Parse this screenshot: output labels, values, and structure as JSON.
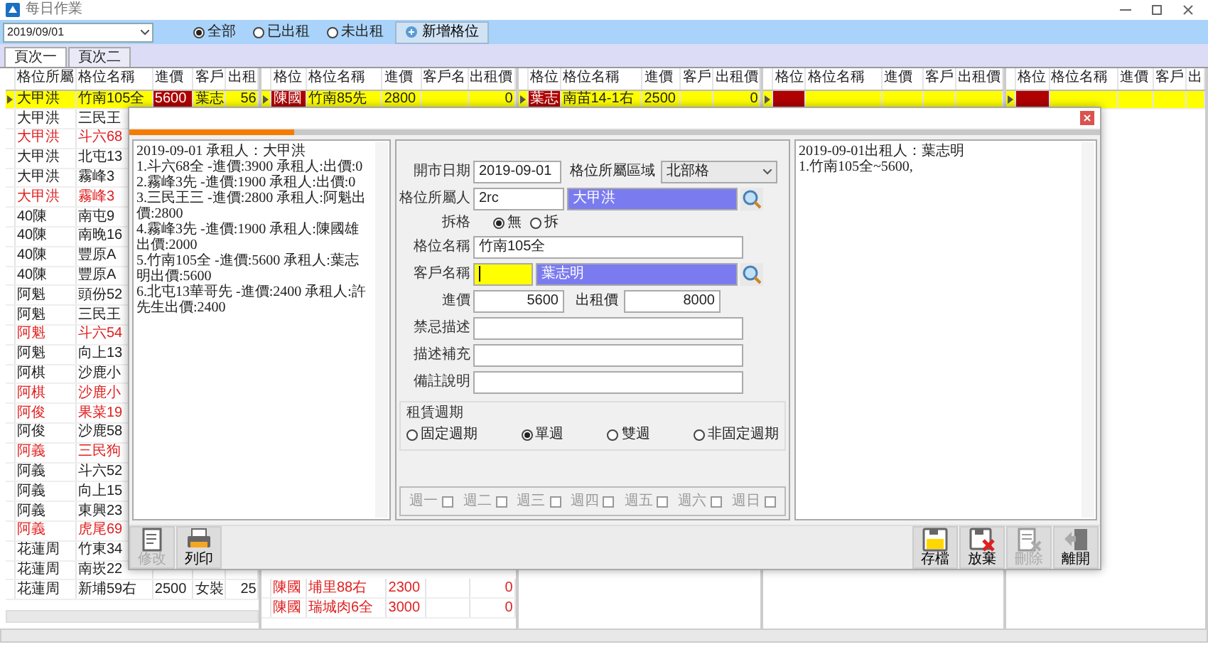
{
  "window": {
    "title": "每日作業"
  },
  "toolbar": {
    "date": "2019/09/01",
    "filters": [
      {
        "label": "全部",
        "selected": true
      },
      {
        "label": "已出租",
        "selected": false
      },
      {
        "label": "未出租",
        "selected": false
      }
    ],
    "add_button": "新增格位"
  },
  "tabs": [
    {
      "label": "頁次一",
      "selected": true
    },
    {
      "label": "頁次二",
      "selected": false
    }
  ],
  "grids": [
    {
      "columns": [
        "格位所屬",
        "格位名稱",
        "進價",
        "客戶",
        "出租"
      ],
      "rows": [
        {
          "cells": [
            "大甲洪",
            "竹南105全",
            {
              "text": "5600",
              "marked": true
            },
            "葉志",
            "56"
          ],
          "selected": true,
          "flagged": false
        },
        {
          "cells": [
            "大甲洪",
            "三民王"
          ],
          "selected": false,
          "flagged": false
        },
        {
          "cells": [
            "大甲洪",
            "斗六68"
          ],
          "selected": false,
          "flagged": true
        },
        {
          "cells": [
            "大甲洪",
            "北屯13"
          ],
          "selected": false,
          "flagged": false
        },
        {
          "cells": [
            "大甲洪",
            "霧峰3"
          ],
          "selected": false,
          "flagged": false
        },
        {
          "cells": [
            "大甲洪",
            "霧峰3"
          ],
          "selected": false,
          "flagged": true
        },
        {
          "cells": [
            "40陳",
            "南屯9"
          ],
          "selected": false,
          "flagged": false
        },
        {
          "cells": [
            "40陳",
            "南晚16"
          ],
          "selected": false,
          "flagged": false
        },
        {
          "cells": [
            "40陳",
            "豐原A"
          ],
          "selected": false,
          "flagged": false
        },
        {
          "cells": [
            "40陳",
            "豐原A"
          ],
          "selected": false,
          "flagged": false
        },
        {
          "cells": [
            "阿魁",
            "頭份52"
          ],
          "selected": false,
          "flagged": false
        },
        {
          "cells": [
            "阿魁",
            "三民王"
          ],
          "selected": false,
          "flagged": false
        },
        {
          "cells": [
            "阿魁",
            "斗六54"
          ],
          "selected": false,
          "flagged": true
        },
        {
          "cells": [
            "阿魁",
            "向上13"
          ],
          "selected": false,
          "flagged": false
        },
        {
          "cells": [
            "阿棋",
            "沙鹿小"
          ],
          "selected": false,
          "flagged": false
        },
        {
          "cells": [
            "阿棋",
            "沙鹿小"
          ],
          "selected": false,
          "flagged": true
        },
        {
          "cells": [
            "阿俊",
            "果菜19"
          ],
          "selected": false,
          "flagged": true
        },
        {
          "cells": [
            "阿俊",
            "沙鹿58"
          ],
          "selected": false,
          "flagged": false
        },
        {
          "cells": [
            "阿義",
            "三民狗"
          ],
          "selected": false,
          "flagged": true
        },
        {
          "cells": [
            "阿義",
            "斗六52"
          ],
          "selected": false,
          "flagged": false
        },
        {
          "cells": [
            "阿義",
            "向上15"
          ],
          "selected": false,
          "flagged": false
        },
        {
          "cells": [
            "阿義",
            "東興23"
          ],
          "selected": false,
          "flagged": false
        },
        {
          "cells": [
            "阿義",
            "虎尾69"
          ],
          "selected": false,
          "flagged": true
        },
        {
          "cells": [
            "花蓮周",
            "竹東34"
          ],
          "selected": false,
          "flagged": false
        },
        {
          "cells": [
            "花蓮周",
            "南崁22"
          ],
          "selected": false,
          "flagged": false
        },
        {
          "cells": [
            "花蓮周",
            "新埔59右",
            "2500",
            "女裝",
            "25"
          ],
          "selected": false,
          "flagged": false
        }
      ]
    },
    {
      "columns": [
        "格位",
        "格位名稱",
        "進價",
        "客戶名",
        "出租價"
      ],
      "rows": [
        {
          "cells": [
            {
              "text": "陳國",
              "marked": true
            },
            "竹南85先",
            "2800",
            null,
            "0"
          ],
          "selected": true,
          "flagged": false
        }
      ],
      "bottom_rows": [
        {
          "cells": [
            "陳國",
            "埔里88右",
            "2300",
            null,
            "0"
          ],
          "selected": false,
          "flagged": true
        },
        {
          "cells": [
            "陳國",
            "瑞城肉6全",
            "3000",
            null,
            "0"
          ],
          "selected": false,
          "flagged": true
        }
      ]
    },
    {
      "columns": [
        "格位",
        "格位名稱",
        "進價",
        "客戶",
        "出租價"
      ],
      "rows": [
        {
          "cells": [
            {
              "text": "葉志",
              "marked": true
            },
            "南苗14-1右",
            "2500",
            null,
            "0"
          ],
          "selected": true,
          "flagged": false
        }
      ]
    },
    {
      "columns": [
        "格位",
        "格位名稱",
        "進價",
        "客戶",
        "出租價"
      ],
      "rows": [
        {
          "cells": [
            {
              "marked": true
            },
            null,
            null,
            null,
            null
          ],
          "selected": true
        }
      ]
    },
    {
      "columns": [
        "格位",
        "格位名稱",
        "進價",
        "客戶",
        "出"
      ],
      "rows": [
        {
          "cells": [
            {
              "marked": true
            },
            null,
            null,
            null,
            null
          ],
          "selected": true
        }
      ]
    }
  ],
  "dialog": {
    "progress": {
      "level": 0.17
    },
    "log_left": [
      "2019-09-01 承租人：大甲洪",
      "1.斗六68全 -進價:3900 承租人:出價:0",
      "2.霧峰3先 -進價:1900 承租人:出價:0",
      "3.三民王三 -進價:2800 承租人:阿魁出價:2800",
      "4.霧峰3先 -進價:1900 承租人:陳國雄出價:2000",
      "5.竹南105全 -進價:5600 承租人:葉志明出價:5600",
      "6.北屯13華哥先 -進價:2400 承租人:許先生出價:2400"
    ],
    "form": {
      "date_label": "開市日期",
      "date": "2019-09-01",
      "area_label": "格位所屬區域",
      "area": "北部格",
      "owner_label": "格位所屬人",
      "owner_code": "2rc",
      "owner_name": "大甲洪",
      "split_label": "拆格",
      "split_options": [
        {
          "label": "無",
          "selected": true
        },
        {
          "label": "拆",
          "selected": false
        }
      ],
      "stall_label": "格位名稱",
      "stall": "竹南105全",
      "customer_label": "客戶名稱",
      "customer_code_focused": true,
      "customer_name": "葉志明",
      "cost_label": "進價",
      "cost": "5600",
      "rent_label": "出租價",
      "rent": "8000",
      "taboo_label": "禁忌描述",
      "extra_label": "描述補充",
      "note_label": "備註說明",
      "cycle_label": "租賃週期",
      "cycle_options": [
        {
          "label": "固定週期",
          "selected": false
        },
        {
          "label": "單週",
          "selected": true
        },
        {
          "label": "雙週",
          "selected": false
        },
        {
          "label": "非固定週期",
          "selected": false
        }
      ],
      "weekdays": {
        "disabled": true,
        "days": [
          {
            "label": "週一",
            "checked": false
          },
          {
            "label": "週二",
            "checked": false
          },
          {
            "label": "週三",
            "checked": false
          },
          {
            "label": "週四",
            "checked": false
          },
          {
            "label": "週五",
            "checked": false
          },
          {
            "label": "週六",
            "checked": false
          },
          {
            "label": "週日",
            "checked": false
          }
        ]
      }
    },
    "log_right": [
      "2019-09-01出租人：葉志明",
      "1.竹南105全~5600,"
    ],
    "buttons_left": [
      {
        "label": "修改",
        "kind": "edit",
        "disabled": true
      },
      {
        "label": "列印",
        "kind": "print",
        "disabled": false
      }
    ],
    "buttons_right": [
      {
        "label": "存檔",
        "kind": "save",
        "disabled": false
      },
      {
        "label": "放棄",
        "kind": "discard",
        "disabled": false
      },
      {
        "label": "刪除",
        "kind": "delete",
        "disabled": true
      },
      {
        "label": "離開",
        "kind": "exit",
        "disabled": false
      }
    ]
  }
}
